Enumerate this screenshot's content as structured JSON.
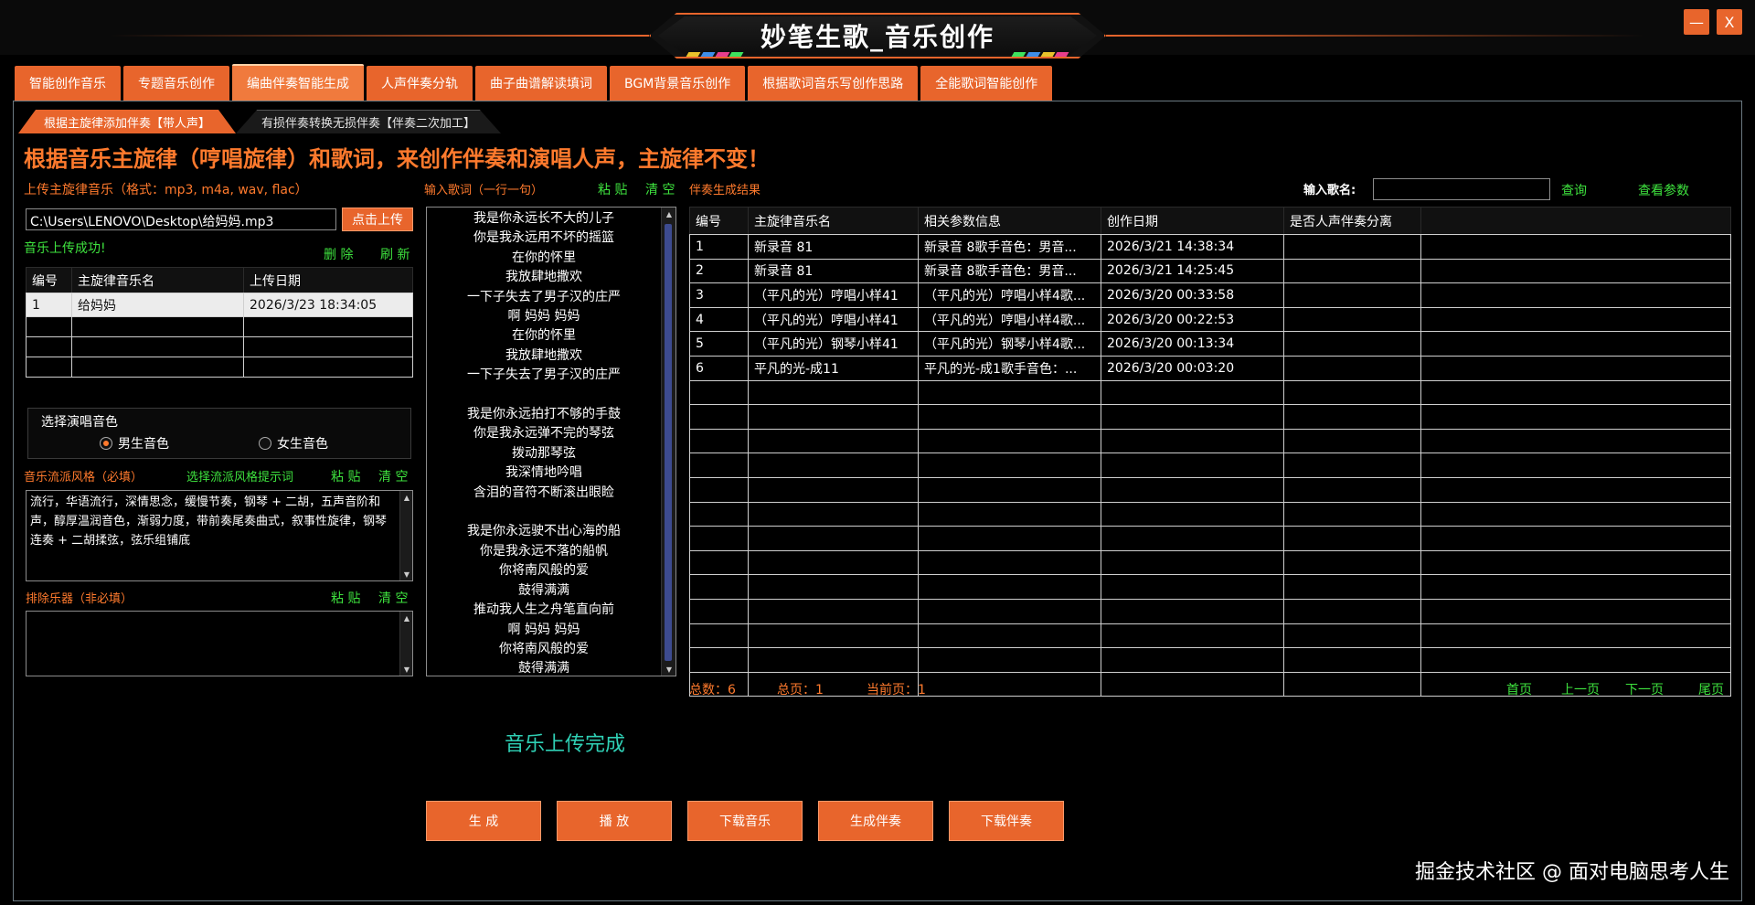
{
  "app": {
    "title": "妙笔生歌_音乐创作",
    "minimize": "—",
    "close": "X"
  },
  "main_tabs": [
    "智能创作音乐",
    "专题音乐创作",
    "编曲伴奏智能生成",
    "人声伴奏分轨",
    "曲子曲谱解读填词",
    "BGM背景音乐创作",
    "根据歌词音乐写创作思路",
    "全能歌词智能创作"
  ],
  "sub_tabs": [
    "根据主旋律添加伴奏【带人声】",
    "有损伴奏转换无损伴奏【伴奏二次加工】"
  ],
  "headline": "根据音乐主旋律（哼唱旋律）和歌词，来创作伴奏和演唱人声，主旋律不变！",
  "upload": {
    "label": "上传主旋律音乐（格式：mp3, m4a, wav, flac）",
    "path": "C:\\Users\\LENOVO\\Desktop\\给妈妈.mp3",
    "button": "点击上传",
    "status": "音乐上传成功!",
    "delete": "删 除",
    "refresh": "刷 新",
    "table": {
      "headers": [
        "编号",
        "主旋律音乐名",
        "上传日期"
      ],
      "rows": [
        [
          "1",
          "给妈妈",
          "2026/3/23 18:34:05"
        ]
      ]
    }
  },
  "voice": {
    "title": "选择演唱音色",
    "male": "男生音色",
    "female": "女生音色"
  },
  "style": {
    "label": "音乐流派风格（必填）",
    "hint": "选择流派风格提示词",
    "paste": "粘 贴",
    "clear": "清 空",
    "text": "流行，华语流行，深情思念，缓慢节奏，钢琴 + 二胡，五声音阶和声，醇厚温润音色，渐弱力度，带前奏尾奏曲式，叙事性旋律，钢琴连奏 + 二胡揉弦，弦乐组铺底"
  },
  "exclude": {
    "label": "排除乐器（非必填）",
    "paste": "粘 贴",
    "clear": "清 空",
    "text": ""
  },
  "lyrics": {
    "label": "输入歌词（一行一句）",
    "paste": "粘 贴",
    "clear": "清 空",
    "lines": [
      "我是你永远长不大的儿子",
      "你是我永远用不坏的摇篮",
      "在你的怀里",
      "我放肆地撒欢",
      "一下子失去了男子汉的庄严",
      "啊 妈妈 妈妈",
      "在你的怀里",
      "我放肆地撒欢",
      "一下子失去了男子汉的庄严",
      "",
      "我是你永远拍打不够的手鼓",
      "你是我永远弹不完的琴弦",
      "拨动那琴弦",
      "我深情地吟唱",
      "含泪的音符不断滚出眼睑",
      "",
      "我是你永远驶不出心海的船",
      "你是我永远不落的船帆",
      "你将南风般的爱",
      "鼓得满满",
      "推动我人生之舟笔直向前",
      "啊 妈妈 妈妈",
      "你将南风般的爱",
      "鼓得满满"
    ]
  },
  "results": {
    "label": "伴奏生成结果",
    "song_name_label": "输入歌名:",
    "song_name_value": "",
    "query": "查询",
    "view_params": "查看参数",
    "headers": [
      "编号",
      "主旋律音乐名",
      "相关参数信息",
      "创作日期",
      "是否人声伴奏分离"
    ],
    "rows": [
      [
        "1",
        "新录音 81",
        "新录音 8歌手音色：男音...",
        "2026/3/21 14:38:34",
        ""
      ],
      [
        "2",
        "新录音 81",
        "新录音 8歌手音色：男音...",
        "2026/3/21 14:25:45",
        ""
      ],
      [
        "3",
        "（平凡的光）哼唱小样41",
        "（平凡的光）哼唱小样4歌...",
        "2026/3/20 00:33:58",
        ""
      ],
      [
        "4",
        "（平凡的光）哼唱小样41",
        "（平凡的光）哼唱小样4歌...",
        "2026/3/20 00:22:53",
        ""
      ],
      [
        "5",
        "（平凡的光）钢琴小样41",
        "（平凡的光）钢琴小样4歌...",
        "2026/3/20 00:13:34",
        ""
      ],
      [
        "6",
        "平凡的光-成11",
        "平凡的光-成1歌手音色：...",
        "2026/3/20 00:03:20",
        ""
      ]
    ],
    "empty_rows": 13,
    "total": "总数：6",
    "pages": "总页：1",
    "current": "当前页：1",
    "first": "首页",
    "prev": "上一页",
    "next": "下一页",
    "last": "尾页"
  },
  "status_big": "音乐上传完成",
  "bottom_buttons": [
    "生 成",
    "播 放",
    "下载音乐",
    "生成伴奏",
    "下载伴奏"
  ],
  "watermark": "掘金技术社区 @ 面对电脑思考人生",
  "colors": {
    "accent": "#e8652c",
    "label_orange": "#ff7a2d",
    "label_green": "#3ee23e",
    "status_teal": "#2fd0b5"
  }
}
